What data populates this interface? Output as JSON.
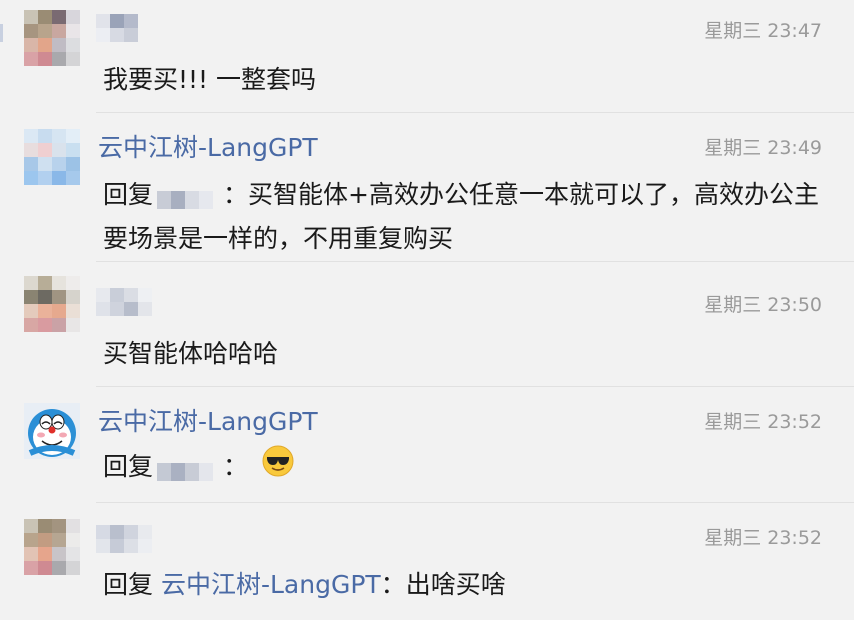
{
  "messages": [
    {
      "time": "星期三 23:47",
      "text": "我要买!!!  一整套吗"
    },
    {
      "sender": "云中江树-LangGPT",
      "time": "星期三 23:49",
      "reply_prefix": "回复",
      "reply_sep": "：",
      "text": "买智能体+高效办公任意一本就可以了，高效办公主要场景是一样的，不用重复购买"
    },
    {
      "time": "星期三 23:50",
      "text": "买智能体哈哈哈"
    },
    {
      "sender": "云中江树-LangGPT",
      "time": "星期三 23:52",
      "reply_prefix": "回复",
      "reply_sep": "：",
      "emoji": "sunglasses-emoji"
    },
    {
      "time": "星期三 23:52",
      "reply_prefix": "回复",
      "reply_target": "云中江树-LangGPT",
      "reply_sep": "：",
      "text": "出啥买啥"
    }
  ],
  "colors": {
    "background": "#f2f2f2",
    "link": "#4a6aa5",
    "time": "#9a9a9a",
    "text": "#1a1a1a"
  }
}
